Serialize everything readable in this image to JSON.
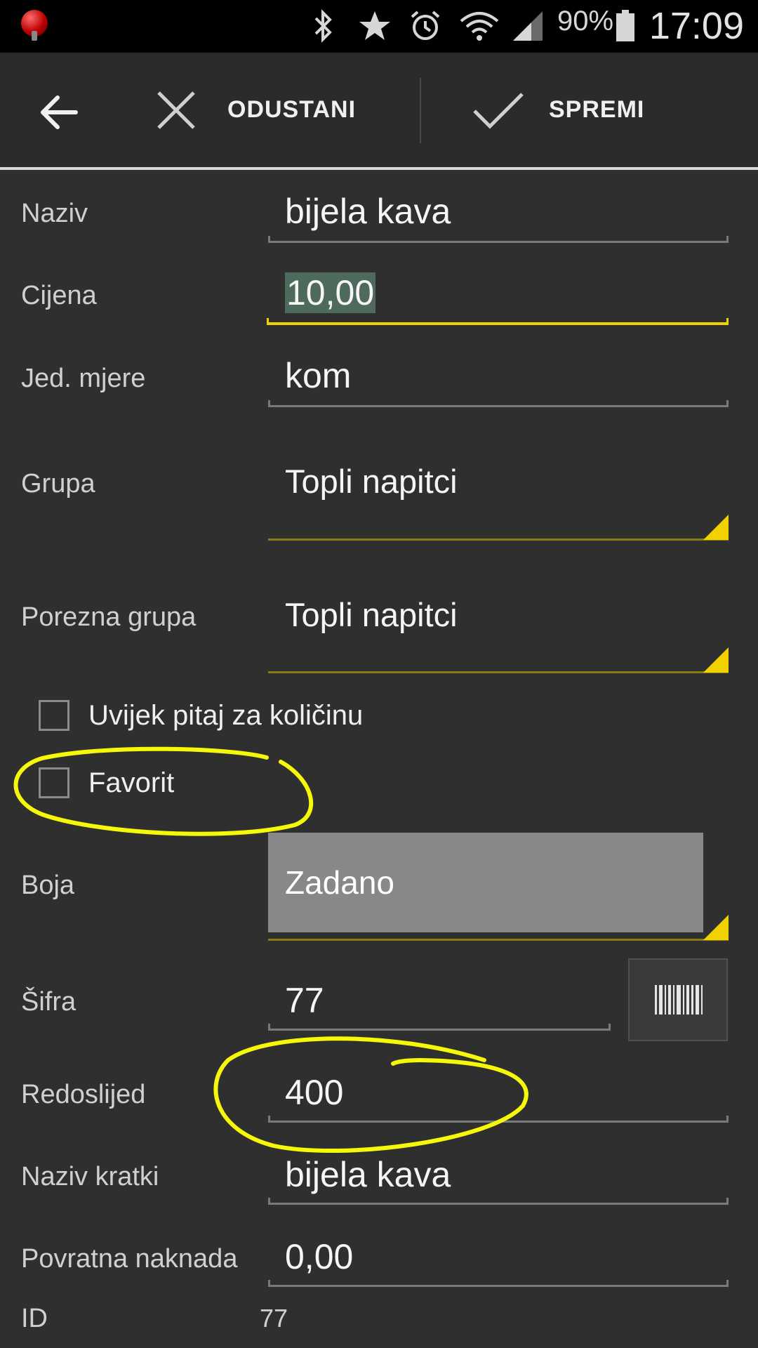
{
  "status_bar": {
    "battery_percent": "90%",
    "time": "17:09"
  },
  "action_bar": {
    "cancel_label": "ODUSTANI",
    "save_label": "SPREMI"
  },
  "form": {
    "naziv": {
      "label": "Naziv",
      "value": "bijela kava"
    },
    "cijena": {
      "label": "Cijena",
      "value": "10,00"
    },
    "jed_mjere": {
      "label": "Jed. mjere",
      "value": "kom"
    },
    "grupa": {
      "label": "Grupa",
      "value": "Topli napitci"
    },
    "porezna_grupa": {
      "label": "Porezna grupa",
      "value": "Topli napitci"
    },
    "uvijek_pitaj": {
      "label": "Uvijek pitaj za količinu",
      "checked": false
    },
    "favorit": {
      "label": "Favorit",
      "checked": false
    },
    "boja": {
      "label": "Boja",
      "value": "Zadano",
      "swatch_color": "#888888"
    },
    "sifra": {
      "label": "Šifra",
      "value": "77"
    },
    "redoslijed": {
      "label": "Redoslijed",
      "value": "400"
    },
    "naziv_kratki": {
      "label": "Naziv kratki",
      "value": "bijela kava"
    },
    "povratna_naknada": {
      "label": "Povratna naknada",
      "value": "0,00"
    },
    "id": {
      "label": "ID",
      "value": "77"
    }
  },
  "colors": {
    "accent": "#f2d100",
    "background": "#2f2f2f",
    "annotation": "#f7f70a"
  }
}
